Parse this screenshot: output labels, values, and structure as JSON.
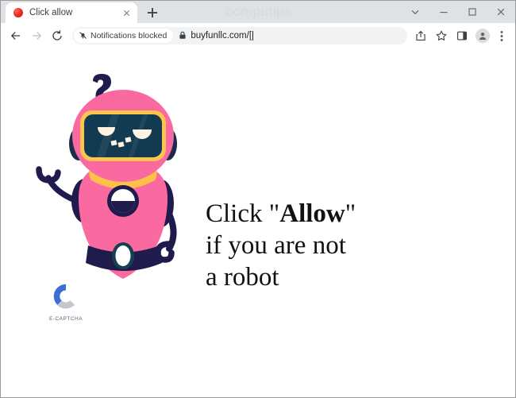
{
  "browser": {
    "watermark": "computips",
    "tab": {
      "title": "Click allow",
      "favicon_name": "red-circle-favicon",
      "close_label": "Close tab"
    },
    "new_tab_label": "New tab",
    "window_controls": [
      {
        "name": "tab-search-button",
        "glyph": "chevron-down"
      },
      {
        "name": "minimize-button",
        "glyph": "minimize"
      },
      {
        "name": "maximize-button",
        "glyph": "maximize"
      },
      {
        "name": "close-window-button",
        "glyph": "close"
      }
    ],
    "toolbar": {
      "back_label": "Back",
      "forward_label": "Forward",
      "reload_label": "Reload",
      "notifications_chip": "Notifications blocked",
      "url": "buyfunllc.com/[",
      "share_label": "Share this page",
      "bookmark_label": "Bookmark this tab",
      "side_panel_label": "Side panel",
      "profile_label": "Profile",
      "menu_label": "Customize and control Google Chrome"
    }
  },
  "page": {
    "headline": {
      "line1_prefix": "Click ",
      "line1_quote_open": "\"",
      "line1_bold": "Allow",
      "line1_quote_close": "\"",
      "line2": "if you are not",
      "line3": "a robot"
    },
    "captcha": {
      "brand": "E-CAPTCHA",
      "logo_name": "e-captcha-logo"
    },
    "mascot": {
      "name": "confused-robot-illustration",
      "thought_glyph": "?"
    }
  },
  "colors": {
    "tabstrip": "#dee1e6",
    "toolbar": "#ffffff",
    "omnibox": "#f1f3f4",
    "robot_pink": "#fa6aa0",
    "robot_navy": "#201b4d",
    "robot_visor": "#123a51",
    "robot_gold": "#ffc44d",
    "robot_cream": "#fdf3e3",
    "captcha_blue": "#3b6fd4",
    "captcha_grey": "#c4c8cc",
    "watermark_grey": "#d6dade"
  }
}
